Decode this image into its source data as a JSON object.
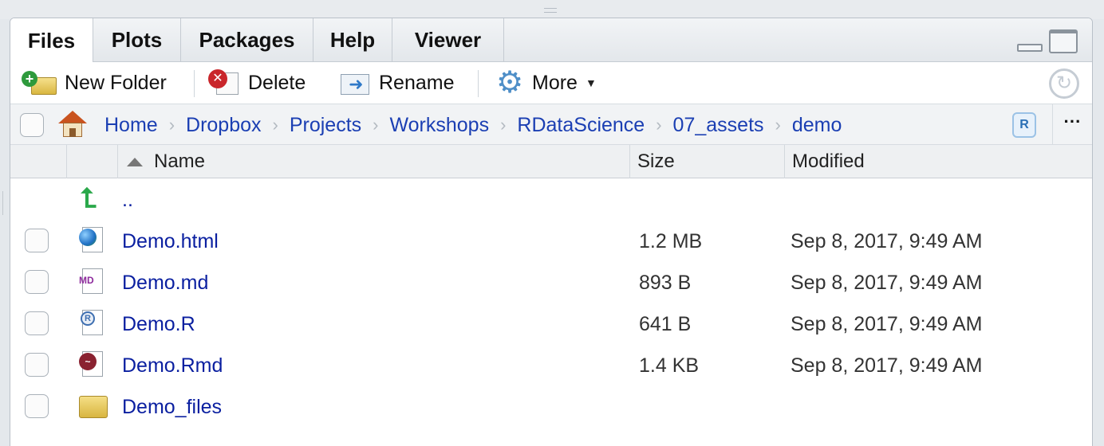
{
  "tabs": [
    "Files",
    "Plots",
    "Packages",
    "Help",
    "Viewer"
  ],
  "toolbar": {
    "new_folder": "New Folder",
    "delete": "Delete",
    "rename": "Rename",
    "more": "More"
  },
  "breadcrumb": [
    "Home",
    "Dropbox",
    "Projects",
    "Workshops",
    "RDataScience",
    "07_assets",
    "demo"
  ],
  "breadcrumb_more": "···",
  "columns": {
    "name": "Name",
    "size": "Size",
    "modified": "Modified"
  },
  "parent_dir": "..",
  "files": [
    {
      "name": "Demo.html",
      "size": "1.2 MB",
      "modified": "Sep 8, 2017, 9:49 AM",
      "icon": "html-file-icon"
    },
    {
      "name": "Demo.md",
      "size": "893 B",
      "modified": "Sep 8, 2017, 9:49 AM",
      "icon": "markdown-file-icon"
    },
    {
      "name": "Demo.R",
      "size": "641 B",
      "modified": "Sep 8, 2017, 9:49 AM",
      "icon": "r-script-file-icon"
    },
    {
      "name": "Demo.Rmd",
      "size": "1.4 KB",
      "modified": "Sep 8, 2017, 9:49 AM",
      "icon": "rmarkdown-file-icon"
    },
    {
      "name": "Demo_files",
      "size": "",
      "modified": "",
      "icon": "folder-icon"
    }
  ],
  "colors": {
    "link": "#0a1fa0",
    "crumb": "#1b3fb3",
    "accent_green": "#2aa84a"
  }
}
